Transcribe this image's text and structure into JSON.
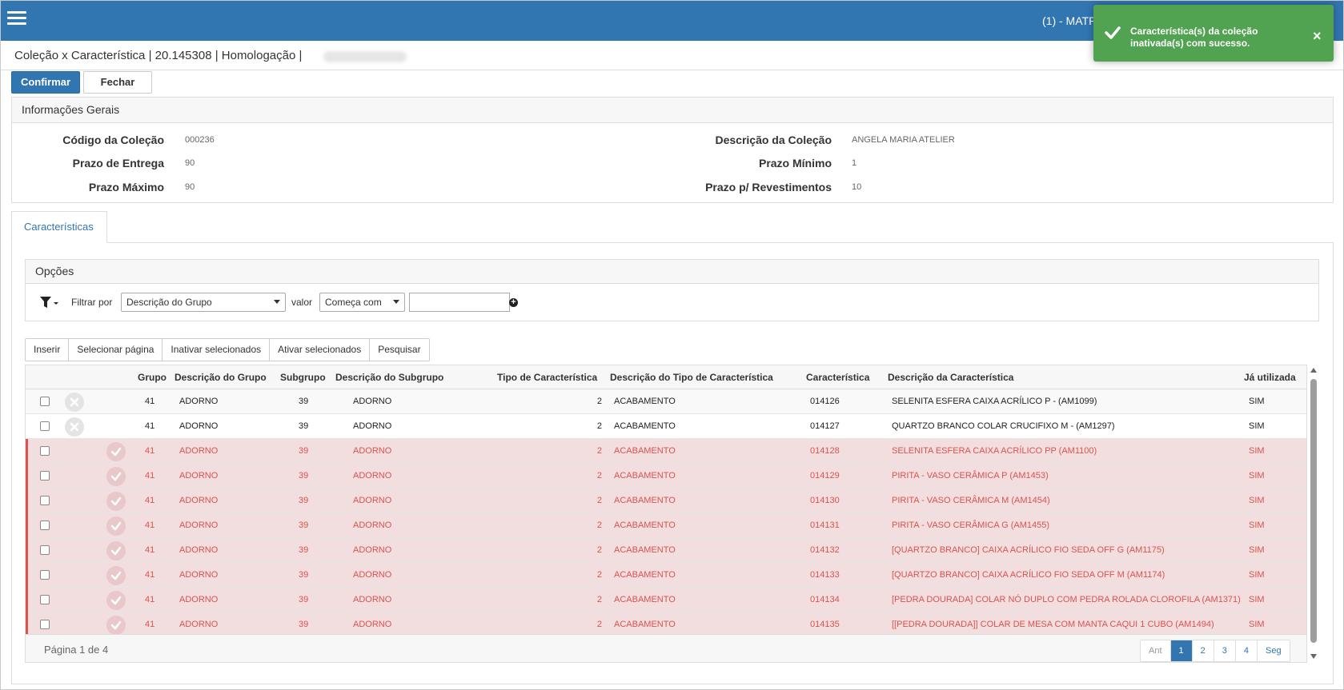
{
  "topbar": {
    "user_label": "(1) - MATR"
  },
  "toast": {
    "message": "Característica(s) da coleção inativada(s) com sucesso.",
    "close": "×"
  },
  "header": {
    "title": "Coleção x Característica | 20.145308 | Homologação |"
  },
  "buttons": {
    "confirm": "Confirmar",
    "close": "Fechar"
  },
  "info": {
    "title": "Informações Gerais",
    "codigo_label": "Código da Coleção",
    "codigo": "000236",
    "descricao_label": "Descrição da Coleção",
    "descricao": "ANGELA MARIA ATELIER",
    "prazo_entrega_label": "Prazo de Entrega",
    "prazo_entrega": "90",
    "prazo_minimo_label": "Prazo Mínimo",
    "prazo_minimo": "1",
    "prazo_maximo_label": "Prazo Máximo",
    "prazo_maximo": "90",
    "prazo_rev_label": "Prazo p/ Revestimentos",
    "prazo_rev": "10"
  },
  "tabs": [
    {
      "label": "Características",
      "active": true
    }
  ],
  "options": {
    "title": "Opções",
    "filter_label": "Filtrar por",
    "filter_value": "Descrição do Grupo",
    "valor_label": "valor",
    "operator_value": "Começa com",
    "value_input": ""
  },
  "actions": [
    "Inserir",
    "Selecionar página",
    "Inativar selecionados",
    "Ativar selecionados",
    "Pesquisar"
  ],
  "table": {
    "headers": {
      "grupo": "Grupo",
      "desc_grupo": "Descrição do Grupo",
      "subgrupo": "Subgrupo",
      "desc_subgrupo": "Descrição do Subgrupo",
      "tipo": "Tipo de Característica",
      "desc_tipo": "Descrição do Tipo de Característica",
      "caracteristica": "Característica",
      "desc_caracteristica": "Descrição da Característica",
      "ja_utilizada": "Já utilizada"
    },
    "rows": [
      {
        "grupo": "41",
        "desc_grupo": "ADORNO",
        "subgrupo": "39",
        "desc_subgrupo": "ADORNO",
        "tipo": "2",
        "desc_tipo": "ACABAMENTO",
        "caracteristica": "014126",
        "desc_caracteristica": "SELENITA ESFERA CAIXA ACRÍLICO P - (AM1099)",
        "ja_utilizada": "SIM",
        "inactive": false
      },
      {
        "grupo": "41",
        "desc_grupo": "ADORNO",
        "subgrupo": "39",
        "desc_subgrupo": "ADORNO",
        "tipo": "2",
        "desc_tipo": "ACABAMENTO",
        "caracteristica": "014127",
        "desc_caracteristica": "QUARTZO BRANCO COLAR CRUCIFIXO M - (AM1297)",
        "ja_utilizada": "SIM",
        "inactive": false
      },
      {
        "grupo": "41",
        "desc_grupo": "ADORNO",
        "subgrupo": "39",
        "desc_subgrupo": "ADORNO",
        "tipo": "2",
        "desc_tipo": "ACABAMENTO",
        "caracteristica": "014128",
        "desc_caracteristica": "SELENITA ESFERA CAIXA ACRÍLICO PP (AM1100)",
        "ja_utilizada": "SIM",
        "inactive": true
      },
      {
        "grupo": "41",
        "desc_grupo": "ADORNO",
        "subgrupo": "39",
        "desc_subgrupo": "ADORNO",
        "tipo": "2",
        "desc_tipo": "ACABAMENTO",
        "caracteristica": "014129",
        "desc_caracteristica": "PIRITA - VASO CERÂMICA P (AM1453)",
        "ja_utilizada": "SIM",
        "inactive": true
      },
      {
        "grupo": "41",
        "desc_grupo": "ADORNO",
        "subgrupo": "39",
        "desc_subgrupo": "ADORNO",
        "tipo": "2",
        "desc_tipo": "ACABAMENTO",
        "caracteristica": "014130",
        "desc_caracteristica": "PIRITA - VASO CERÂMICA M (AM1454)",
        "ja_utilizada": "SIM",
        "inactive": true
      },
      {
        "grupo": "41",
        "desc_grupo": "ADORNO",
        "subgrupo": "39",
        "desc_subgrupo": "ADORNO",
        "tipo": "2",
        "desc_tipo": "ACABAMENTO",
        "caracteristica": "014131",
        "desc_caracteristica": "PIRITA - VASO CERÂMICA G (AM1455)",
        "ja_utilizada": "SIM",
        "inactive": true
      },
      {
        "grupo": "41",
        "desc_grupo": "ADORNO",
        "subgrupo": "39",
        "desc_subgrupo": "ADORNO",
        "tipo": "2",
        "desc_tipo": "ACABAMENTO",
        "caracteristica": "014132",
        "desc_caracteristica": "[QUARTZO BRANCO] CAIXA ACRÍLICO FIO SEDA OFF G (AM1175)",
        "ja_utilizada": "SIM",
        "inactive": true
      },
      {
        "grupo": "41",
        "desc_grupo": "ADORNO",
        "subgrupo": "39",
        "desc_subgrupo": "ADORNO",
        "tipo": "2",
        "desc_tipo": "ACABAMENTO",
        "caracteristica": "014133",
        "desc_caracteristica": "[QUARTZO BRANCO] CAIXA ACRÍLICO FIO SEDA OFF M (AM1174)",
        "ja_utilizada": "SIM",
        "inactive": true
      },
      {
        "grupo": "41",
        "desc_grupo": "ADORNO",
        "subgrupo": "39",
        "desc_subgrupo": "ADORNO",
        "tipo": "2",
        "desc_tipo": "ACABAMENTO",
        "caracteristica": "014134",
        "desc_caracteristica": "[PEDRA DOURADA] COLAR NÓ DUPLO COM PEDRA ROLADA CLOROFILA (AM1371)",
        "ja_utilizada": "SIM",
        "inactive": true
      },
      {
        "grupo": "41",
        "desc_grupo": "ADORNO",
        "subgrupo": "39",
        "desc_subgrupo": "ADORNO",
        "tipo": "2",
        "desc_tipo": "ACABAMENTO",
        "caracteristica": "014135",
        "desc_caracteristica": "[[PEDRA DOURADA]] COLAR DE MESA COM MANTA CAQUI 1 CUBO (AM1494)",
        "ja_utilizada": "SIM",
        "inactive": true
      }
    ],
    "page_info": "Página 1 de 4"
  },
  "pagination": {
    "prev": "Ant",
    "pages": [
      "1",
      "2",
      "3",
      "4"
    ],
    "active": "1",
    "next": "Seg"
  },
  "colors": {
    "primary": "#3276b1",
    "success": "#51a351",
    "inactive_bg": "#f2dede",
    "inactive_text": "#d9534f"
  },
  "icons": {
    "menu": "hamburger-icon",
    "toast": "check-icon",
    "filter": "filter-icon",
    "add": "plus-circle-icon",
    "deactivate": "x-circle-icon",
    "activate": "check-circle-icon"
  }
}
